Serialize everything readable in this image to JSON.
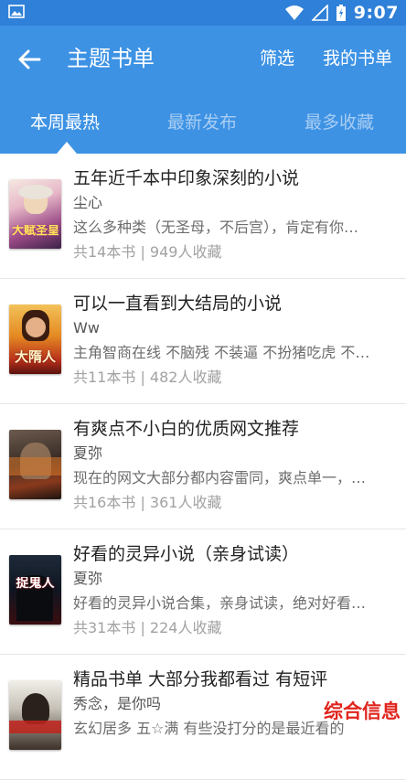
{
  "status_bar": {
    "time": "9:07"
  },
  "header": {
    "title": "主题书单",
    "filter_label": "筛选",
    "my_booklist_label": "我的书单"
  },
  "tabs": [
    {
      "label": "本周最热",
      "active": true
    },
    {
      "label": "最新发布",
      "active": false
    },
    {
      "label": "最多收藏",
      "active": false
    }
  ],
  "booklists": [
    {
      "title": "五年近千本中印象深刻的小说",
      "author": "尘心",
      "desc": "这么多种类（无圣母，不后宫），肯定有你…",
      "meta": "共14本书 | 949人收藏",
      "cover_text": "大赋圣皇"
    },
    {
      "title": "可以一直看到大结局的小说",
      "author": "Ww",
      "desc": "主角智商在线 不脑残 不装逼 不扮猪吃虎 不…",
      "meta": "共11本书 | 482人收藏",
      "cover_text": "大隋人"
    },
    {
      "title": "有爽点不小白的优质网文推荐",
      "author": "夏弥",
      "desc": "现在的网文大部分都内容雷同，爽点单一，…",
      "meta": "共16本书 | 361人收藏",
      "cover_text": ""
    },
    {
      "title": "好看的灵异小说（亲身试读）",
      "author": "夏弥",
      "desc": "好看的灵异小说合集，亲身试读，绝对好看…",
      "meta": "共31本书 | 224人收藏",
      "cover_text": "捉鬼人"
    },
    {
      "title": "精品书单  大部分我都看过 有短评",
      "author": "秀念，是你吗",
      "desc": "玄幻居多 五☆满 有些没打分的是最近看的",
      "meta": "",
      "cover_text": ""
    }
  ],
  "watermark": "综合信息",
  "colors": {
    "header": "#3d92e4",
    "status_bar": "#2f80d8",
    "watermark": "#e0241d"
  }
}
